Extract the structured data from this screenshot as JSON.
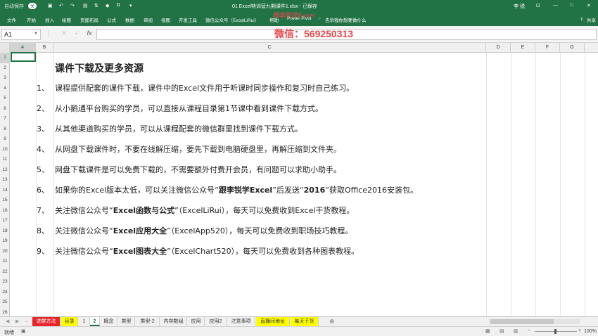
{
  "titlebar": {
    "autosave": "自动保存",
    "autosave_state": "关",
    "title": "01 Excel特训营九期课件1.xlsx - 已保存",
    "user": "李 锐",
    "minimize": "—",
    "restore": "□",
    "close": "✕"
  },
  "ribbon": {
    "tabs": [
      "文件",
      "开始",
      "插入",
      "绘图",
      "页面布局",
      "公式",
      "数据",
      "审阅",
      "视图",
      "开发工具",
      "微信公众号（ExcelLiRui）",
      "帮助",
      "Power Pivot",
      "告诉我你想要做什么"
    ],
    "share": "共享"
  },
  "watermark": {
    "top": "跟李锐学Excel",
    "phone": "微信：569250313"
  },
  "formula_bar": {
    "name_box": "A1",
    "cancel": "✕",
    "enter": "✓",
    "fx": "fx",
    "formula": ""
  },
  "columns": [
    "A",
    "B",
    "C",
    "D",
    "E",
    "F",
    "G"
  ],
  "rows": [
    "1",
    "2",
    "3",
    "4",
    "5",
    "6",
    "7",
    "8",
    "9",
    "10",
    "11",
    "12",
    "13",
    "14",
    "15",
    "16",
    "17",
    "18",
    "19",
    "20",
    "21",
    "22",
    "23",
    "24",
    "25",
    "26"
  ],
  "sheet": {
    "heading": "课件下载及更多资源",
    "items": [
      {
        "num": "1、",
        "text": "课程提供配套的课件下载，课件中的Excel文件用于听课时同步操作和复习时自己练习。"
      },
      {
        "num": "2、",
        "text": "从小鹅通平台购买的学员，可以直接从课程目录第1节课中看到课件下载方式。"
      },
      {
        "num": "3、",
        "text": "从其他渠道购买的学员，可以从课程配套的微信群里找到课件下载方式。"
      },
      {
        "num": "4、",
        "text": "从网盘下载课件时，不要在线解压缩，要先下载到电脑硬盘里，再解压缩到文件夹。"
      },
      {
        "num": "5、",
        "text": "网盘下载课件是可以免费下载的，不需要额外付费开会员，有问题可以求助小助手。"
      },
      {
        "num": "6、",
        "p1": "如果你的Excel版本太低，可以关注微信公众号“",
        "b1": "跟李锐学Excel",
        "p2": "”后发送“",
        "b2": "2016",
        "p3": "”获取Office2016安装包。"
      },
      {
        "num": "7、",
        "p1": "关注微信公众号“",
        "b1": "Excel函数与公式",
        "p2": "”（ExcelLiRui），每天可以免费收到Excel干货教程。"
      },
      {
        "num": "8、",
        "p1": "关注微信公众号“",
        "b1": "Excel应用大全",
        "p2": "”（ExcelApp520），每天可以免费收到职场技巧教程。"
      },
      {
        "num": "9、",
        "p1": "关注微信公众号“",
        "b1": "Excel图表大全",
        "p2": "”（ExcelChart520），每天可以免费收到各种图表教程。"
      }
    ]
  },
  "sheet_tabs": [
    "进群方法",
    "目录",
    "1",
    "2",
    "概念",
    "类型",
    "类型-2",
    "内存数组",
    "应用",
    "应用2",
    "注意事项",
    "直播间地址",
    "每天干货"
  ],
  "add_sheet": "⊕",
  "status": {
    "ready": "就绪",
    "zoom": "100%",
    "zoom_minus": "−",
    "zoom_plus": "+"
  },
  "colors": {
    "excel_green": "#217346",
    "tab_red": "#e8242a",
    "tab_yellow": "#ffff00",
    "watermark_red": "#e8474c"
  }
}
